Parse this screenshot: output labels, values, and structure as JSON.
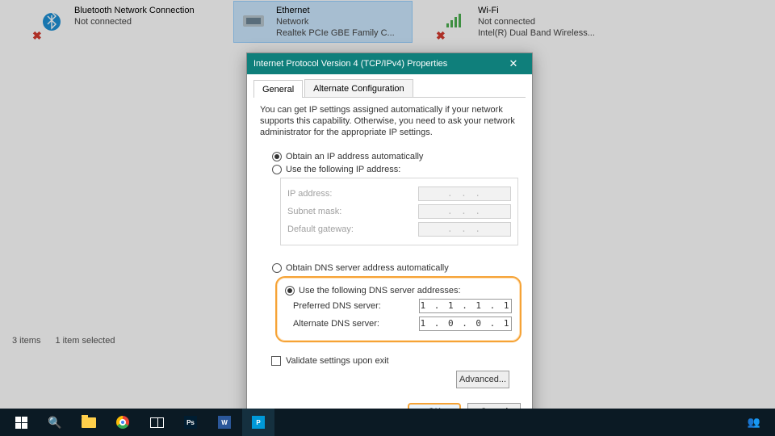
{
  "adapters": [
    {
      "name": "Bluetooth Network Connection",
      "line2": "Not connected",
      "line3": ""
    },
    {
      "name": "Ethernet",
      "line2": "Network",
      "line3": "Realtek PCIe GBE Family C..."
    },
    {
      "name": "Wi-Fi",
      "line2": "Not connected",
      "line3": "Intel(R) Dual Band Wireless..."
    }
  ],
  "status": {
    "items": "3 items",
    "selected": "1 item selected"
  },
  "dialog": {
    "title": "Internet Protocol Version 4 (TCP/IPv4) Properties",
    "tabs": {
      "general": "General",
      "alt": "Alternate Configuration"
    },
    "intro": "You can get IP settings assigned automatically if your network supports this capability. Otherwise, you need to ask your network administrator for the appropriate IP settings.",
    "ip_auto": "Obtain an IP address automatically",
    "ip_manual": "Use the following IP address:",
    "lbl_ip": "IP address:",
    "lbl_mask": "Subnet mask:",
    "lbl_gw": "Default gateway:",
    "dot_placeholder": ".       .       .",
    "dns_auto": "Obtain DNS server address automatically",
    "dns_manual": "Use the following DNS server addresses:",
    "lbl_dns1": "Preferred DNS server:",
    "lbl_dns2": "Alternate DNS server:",
    "dns1": "1  .  1  .  1  .  1",
    "dns2": "1  .  0  .  0  .  1",
    "validate": "Validate settings upon exit",
    "advanced": "Advanced...",
    "ok": "OK",
    "cancel": "Cancel"
  }
}
